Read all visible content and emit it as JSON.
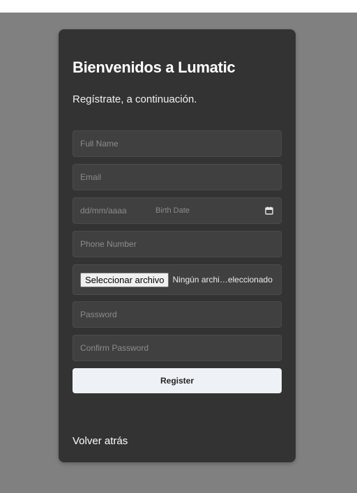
{
  "form": {
    "title": "Bienvenidos a Lumatic",
    "subtitle": "Regístrate, a continuación.",
    "full_name_placeholder": "Full Name",
    "email_placeholder": "Email",
    "date_placeholder": "dd/mm/aaaa",
    "birth_date_label": "Birth Date",
    "phone_placeholder": "Phone Number",
    "file_button_label": "Seleccionar archivo",
    "file_status": "Ningún archi…eleccionado",
    "password_placeholder": "Password",
    "confirm_password_placeholder": "Confirm Password",
    "register_label": "Register",
    "back_link": "Volver atrás"
  },
  "icons": {
    "calendar": "calendar-icon"
  },
  "colors": {
    "page_background": "#808080",
    "card_background": "#333333",
    "field_background": "#404040",
    "button_background": "#eef2f6"
  }
}
